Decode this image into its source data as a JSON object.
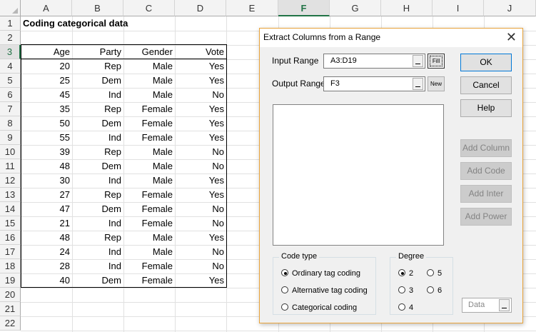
{
  "spreadsheet": {
    "columns": [
      "A",
      "B",
      "C",
      "D",
      "E",
      "F",
      "G",
      "H",
      "I",
      "J"
    ],
    "selected_column": "F",
    "rows": [
      "1",
      "2",
      "3",
      "4",
      "5",
      "6",
      "7",
      "8",
      "9",
      "10",
      "11",
      "12",
      "13",
      "14",
      "15",
      "16",
      "17",
      "18",
      "19",
      "20",
      "21",
      "22"
    ],
    "selected_row": "3",
    "title": "Coding categorical data",
    "headers": [
      "Age",
      "Party",
      "Gender",
      "Vote"
    ],
    "data": [
      [
        "20",
        "Rep",
        "Male",
        "Yes"
      ],
      [
        "25",
        "Dem",
        "Male",
        "Yes"
      ],
      [
        "45",
        "Ind",
        "Male",
        "No"
      ],
      [
        "35",
        "Rep",
        "Female",
        "Yes"
      ],
      [
        "50",
        "Dem",
        "Female",
        "Yes"
      ],
      [
        "55",
        "Ind",
        "Female",
        "Yes"
      ],
      [
        "39",
        "Rep",
        "Male",
        "No"
      ],
      [
        "48",
        "Dem",
        "Male",
        "No"
      ],
      [
        "30",
        "Ind",
        "Male",
        "Yes"
      ],
      [
        "27",
        "Rep",
        "Female",
        "Yes"
      ],
      [
        "47",
        "Dem",
        "Female",
        "No"
      ],
      [
        "21",
        "Ind",
        "Female",
        "No"
      ],
      [
        "48",
        "Rep",
        "Male",
        "Yes"
      ],
      [
        "24",
        "Ind",
        "Male",
        "No"
      ],
      [
        "28",
        "Ind",
        "Female",
        "No"
      ],
      [
        "40",
        "Dem",
        "Female",
        "Yes"
      ]
    ]
  },
  "dialog": {
    "title": "Extract Columns from a Range",
    "close_glyph": "✕",
    "input_range_label": "Input Range",
    "input_range_value": "A3:D19",
    "fill_button": "Fill",
    "output_range_label": "Output Range",
    "output_range_value": "F3",
    "new_button": "New",
    "buttons": {
      "ok": "OK",
      "cancel": "Cancel",
      "help": "Help",
      "add_column": "Add Column",
      "add_code": "Add Code",
      "add_inter": "Add Inter",
      "add_power": "Add Power"
    },
    "code_type": {
      "title": "Code type",
      "options": [
        "Ordinary tag coding",
        "Alternative tag coding",
        "Categorical coding"
      ],
      "selected": "Ordinary tag coding"
    },
    "degree": {
      "title": "Degree",
      "options": [
        "2",
        "5",
        "3",
        "6",
        "4"
      ],
      "selected": "2"
    },
    "data_placeholder": "Data"
  }
}
